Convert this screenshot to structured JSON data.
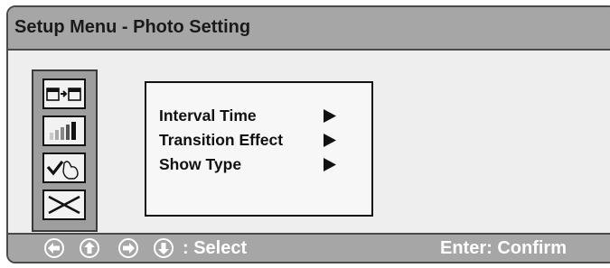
{
  "window": {
    "title": "Setup Menu - Photo Setting"
  },
  "sidebar": {
    "icons": [
      {
        "name": "photo-copy-icon"
      },
      {
        "name": "level-bars-icon"
      },
      {
        "name": "check-hand-icon"
      },
      {
        "name": "exit-cross-icon"
      }
    ]
  },
  "menu": {
    "items": [
      {
        "label": "Interval Time"
      },
      {
        "label": "Transition Effect"
      },
      {
        "label": "Show Type"
      }
    ]
  },
  "footer": {
    "nav_keys": [
      "left-arrow-key-icon",
      "up-arrow-key-icon",
      "right-arrow-key-icon",
      "down-arrow-key-icon"
    ],
    "select_hint": ": Select",
    "confirm_hint": "Enter: Confirm"
  },
  "colors": {
    "bar_gray": "#a6a6a6",
    "panel_gray": "#eeeeee",
    "icon_strip_gray": "#9e9e9e",
    "border_dark": "#4a4a4a",
    "footer_text": "#ffffff"
  }
}
